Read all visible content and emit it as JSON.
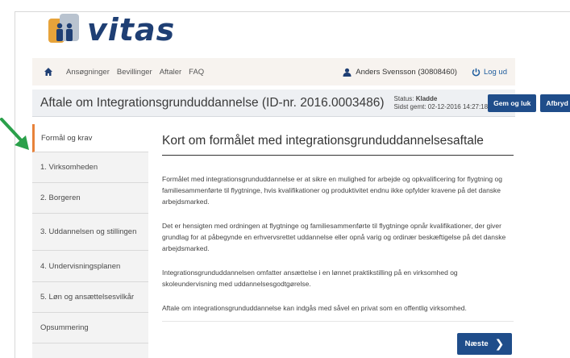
{
  "brand": {
    "name": "vitas"
  },
  "nav": {
    "items": [
      "Ansøgninger",
      "Bevillinger",
      "Aftaler",
      "FAQ"
    ],
    "user": "Anders Svensson (30808460)",
    "logout": "Log ud"
  },
  "header": {
    "title": "Aftale om Integrationsgrunduddannelse (ID-nr. 2016.0003486)",
    "status_label": "Status:",
    "status_value": "Kladde",
    "saved_label": "Sidst gemt:",
    "saved_value": "02-12-2016 14:27:18",
    "save_close": "Gem og luk",
    "cancel": "Afbryd"
  },
  "sidebar": {
    "items": [
      {
        "label": "Formål og krav",
        "active": true
      },
      {
        "label": "1. Virksomheden"
      },
      {
        "label": "2. Borgeren"
      },
      {
        "label": "3. Uddannelsen og stillingen"
      },
      {
        "label": "4. Undervisningsplanen"
      },
      {
        "label": "5. Løn og ansættelsesvilkår"
      },
      {
        "label": "Opsummering"
      }
    ]
  },
  "main": {
    "heading": "Kort om formålet med integrationsgrunduddannelsesaftale",
    "paragraphs": [
      "Formålet med integrationsgrunduddannelse er at sikre en mulighed for arbejde og opkvalificering for flygtning og familiesammenførte til flygtninge, hvis kvalifikationer og produktivitet endnu ikke opfylder kravene på det danske arbejdsmarked.",
      "Det er hensigten med ordningen at flygtninge og familiesammenførte til flygtninge opnår kvalifikationer, der giver grundlag for at påbegynde en erhvervsrettet uddannelse eller opnå varig og ordinær beskæftigelse på det danske arbejdsmarked.",
      "Integrationsgrunduddannelsen omfatter ansættelse i en lønnet praktikstilling på en virksomhed og skoleundervisning med uddannelsesgodtgørelse.",
      "Aftale om integrationsgrunduddannelse kan indgås med såvel en privat som en offentlig virksomhed."
    ],
    "next": "Næste"
  },
  "colors": {
    "primary": "#1f4d8a",
    "brand_text": "#1f3f74",
    "accent": "#e8823a",
    "arrow": "#2aa04a"
  }
}
